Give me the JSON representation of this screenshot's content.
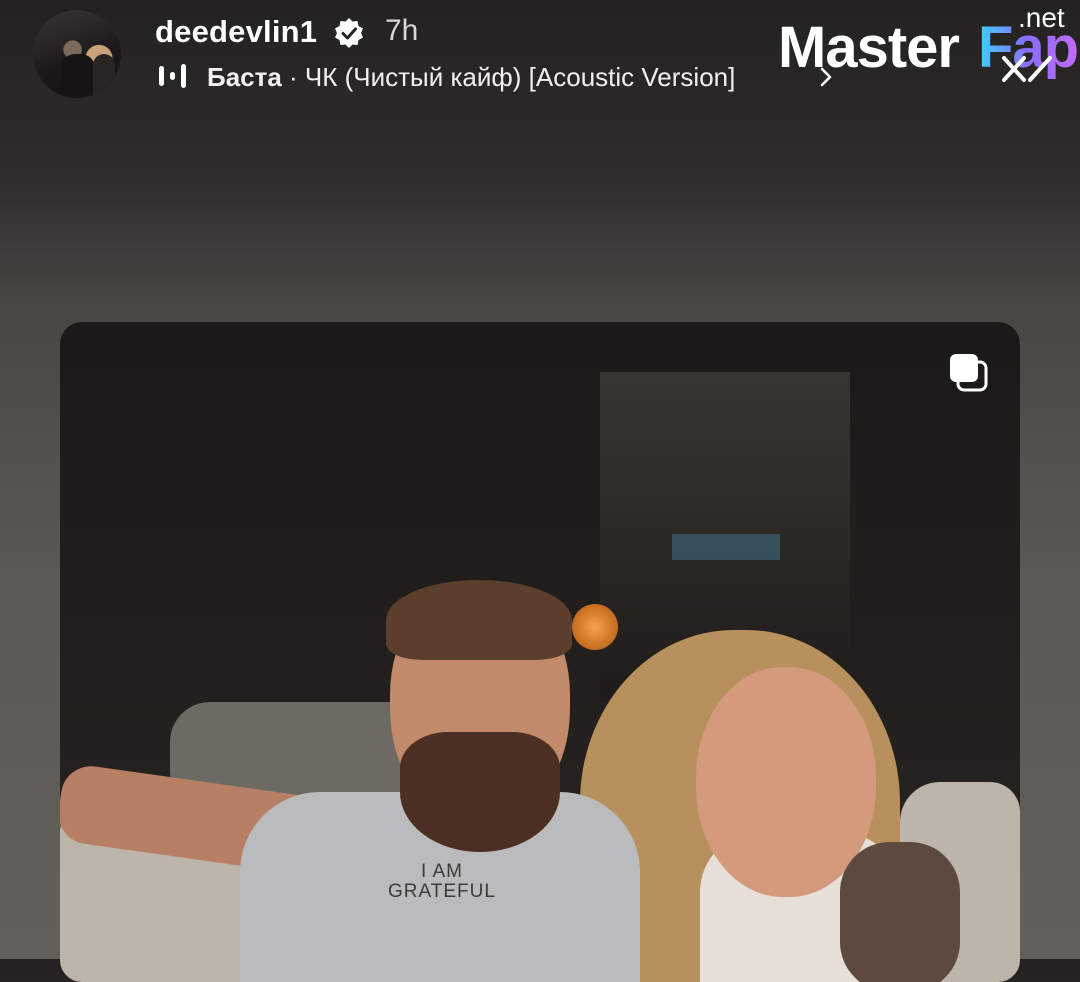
{
  "header": {
    "username": "deedevlin1",
    "verified_icon": "verified-badge-icon",
    "time": "7h",
    "music": {
      "icon": "audio-bars-icon",
      "artist": "Баста",
      "separator": " · ",
      "track": "ЧК (Чистый кайф) [Acoustic Version]"
    }
  },
  "watermark": {
    "master": "Master",
    "fap": "Fap",
    "net": ".net"
  },
  "photo": {
    "shirt_line1": "I AM",
    "shirt_line2": "GRATEFUL",
    "carousel_icon": "multiple-images-icon"
  },
  "colors": {
    "background_top": "#232220",
    "background_bottom": "#63605b",
    "watermark_gradient_start": "#3fd0ff",
    "watermark_gradient_end": "#c36bff"
  }
}
